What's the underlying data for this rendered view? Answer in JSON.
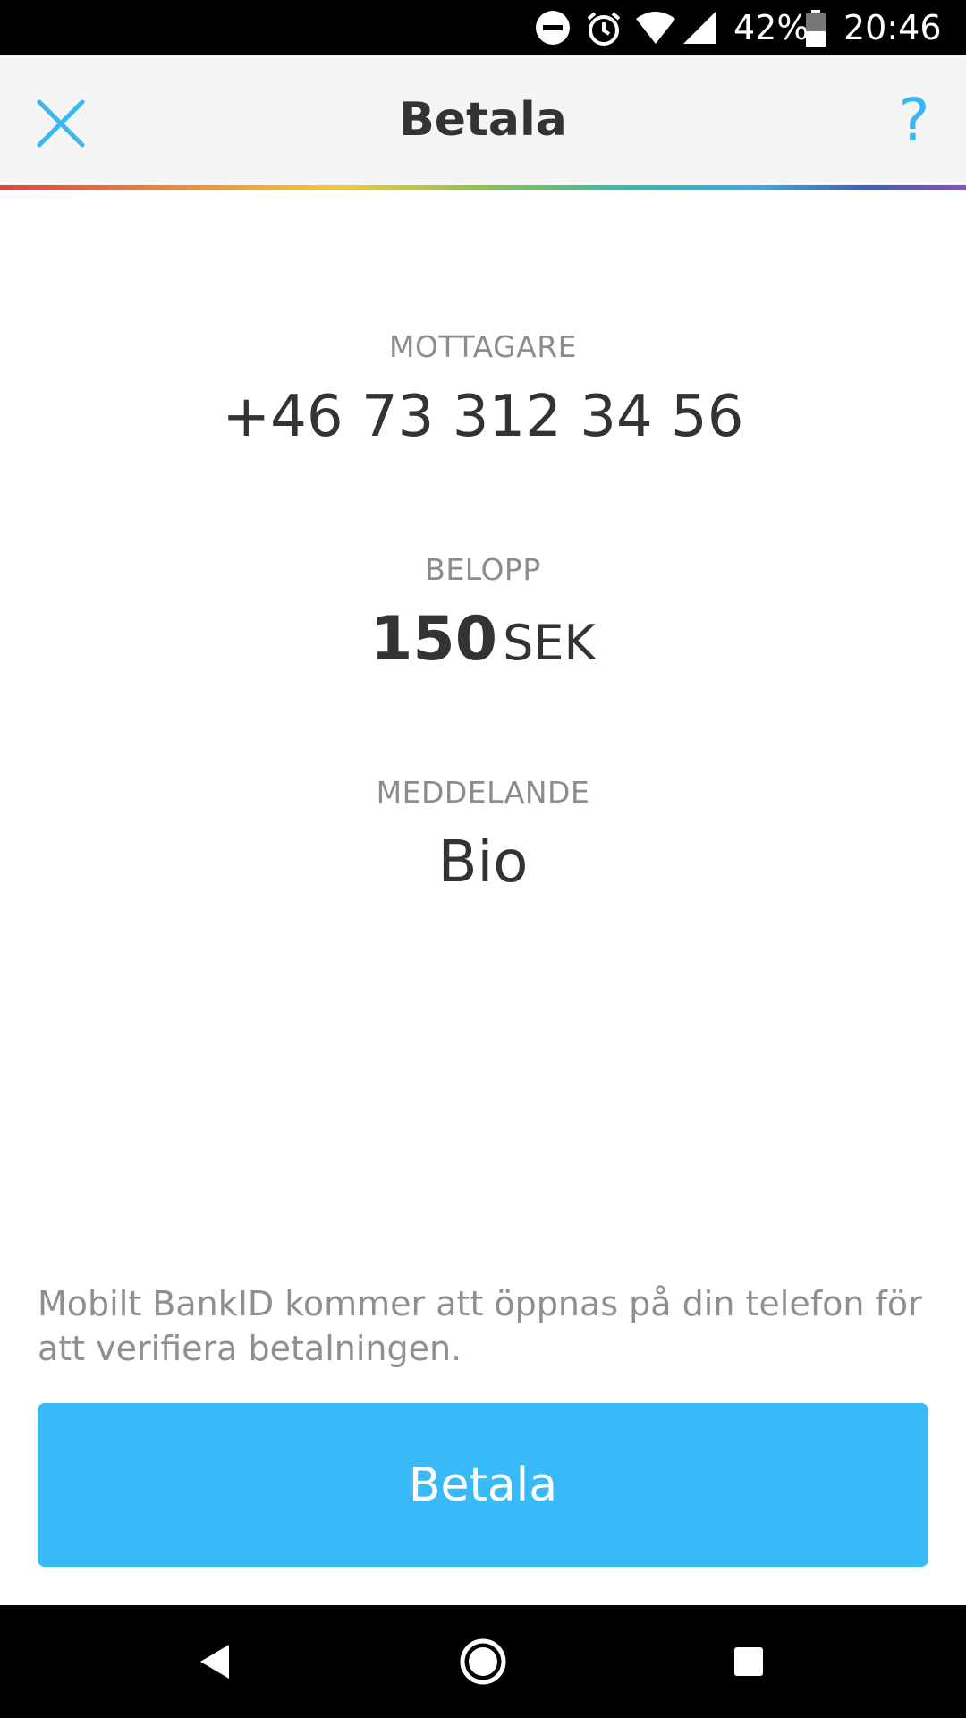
{
  "status_bar": {
    "battery_percent": "42%",
    "time": "20:46",
    "icons": [
      "do-not-disturb-icon",
      "alarm-icon",
      "wifi-icon",
      "signal-icon",
      "battery-icon"
    ]
  },
  "header": {
    "title": "Betala",
    "close_icon": "close-icon",
    "help_label": "?"
  },
  "payment": {
    "recipient_label": "MOTTAGARE",
    "recipient_value": "+46 73 312 34 56",
    "amount_label": "BELOPP",
    "amount_value": "150",
    "amount_currency": "SEK",
    "message_label": "MEDDELANDE",
    "message_value": "Bio"
  },
  "notice": "Mobilt BankID kommer att öppnas på din telefon för att verifiera betalningen.",
  "pay_button_label": "Betala",
  "colors": {
    "accent": "#39b9f6",
    "header_bg": "#f5f5f5",
    "label_gray": "#8c8c8c",
    "text_dark": "#333333"
  },
  "nav_bar": {
    "icons": [
      "back-icon",
      "home-icon",
      "recents-icon"
    ]
  }
}
